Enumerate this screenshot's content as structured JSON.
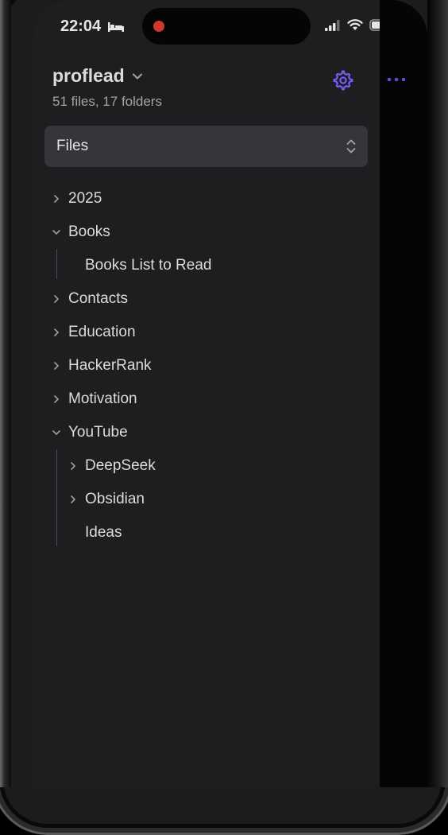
{
  "status_bar": {
    "time": "22:04"
  },
  "vault": {
    "name": "proflead",
    "stats": "51 files, 17 folders"
  },
  "view_selector": {
    "label": "Files"
  },
  "tree": {
    "items": [
      {
        "label": "2025",
        "depth": 0,
        "type": "folder",
        "expanded": false
      },
      {
        "label": "Books",
        "depth": 0,
        "type": "folder",
        "expanded": true
      },
      {
        "label": "Books List to Read",
        "depth": 1,
        "type": "file"
      },
      {
        "label": "Contacts",
        "depth": 0,
        "type": "folder",
        "expanded": false
      },
      {
        "label": "Education",
        "depth": 0,
        "type": "folder",
        "expanded": false
      },
      {
        "label": "HackerRank",
        "depth": 0,
        "type": "folder",
        "expanded": false
      },
      {
        "label": "Motivation",
        "depth": 0,
        "type": "folder",
        "expanded": false
      },
      {
        "label": "YouTube",
        "depth": 0,
        "type": "folder",
        "expanded": true
      },
      {
        "label": "DeepSeek",
        "depth": 1,
        "type": "folder",
        "expanded": false
      },
      {
        "label": "Obsidian",
        "depth": 1,
        "type": "folder",
        "expanded": false
      },
      {
        "label": "Ideas",
        "depth": 1,
        "type": "file"
      }
    ]
  },
  "colors": {
    "accent": "#7c5cff",
    "sidebar_bg": "#1e1e20",
    "selector_bg": "#36363a",
    "text": "#dcdcdc",
    "muted_text": "#a4a4a4"
  },
  "icons": {
    "sleep": "bed-icon",
    "recording": "recording-dot-icon",
    "signal": "cellular-signal-icon",
    "wifi": "wifi-icon",
    "battery": "battery-icon",
    "vault_switch": "chevron-down-icon",
    "settings": "gear-icon",
    "more": "more-horizontal-icon",
    "selector": "up-down-chevron-icon"
  }
}
